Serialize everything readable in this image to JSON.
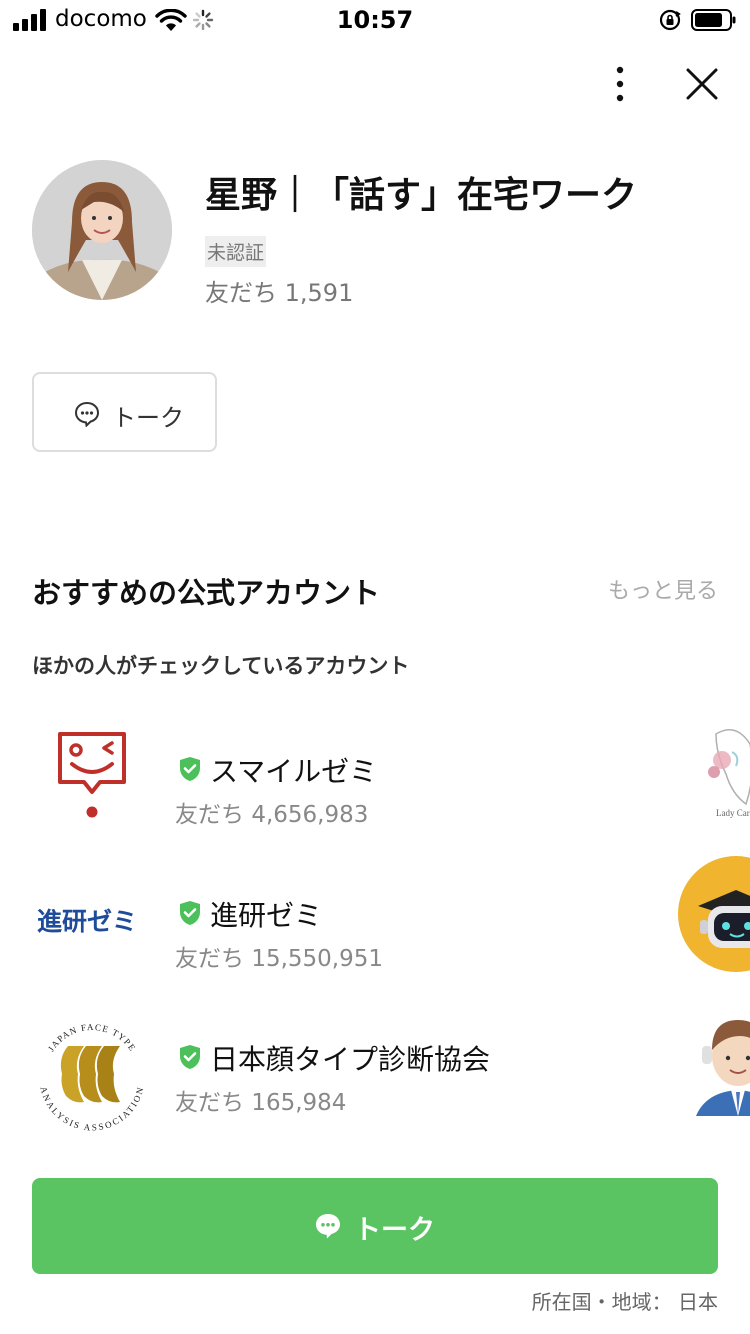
{
  "status_bar": {
    "carrier": "docomo",
    "time": "10:57",
    "signal_icon": "signal-bars-icon",
    "wifi_icon": "wifi-icon",
    "loading_icon": "activity-spinner-icon",
    "rotation_lock_icon": "rotation-lock-icon",
    "battery_icon": "battery-icon"
  },
  "header": {
    "more_icon": "vertical-ellipsis-icon",
    "close_icon": "close-icon"
  },
  "profile": {
    "name": "星野｜「話す」在宅ワーク",
    "verification": "未認証",
    "friends_label": "友だち",
    "friends_count": "1,591",
    "talk_button": "トーク",
    "talk_icon": "chat-bubble-icon"
  },
  "recommendations": {
    "title": "おすすめの公式アカウント",
    "see_more": "もっと見る",
    "subtitle": "ほかの人がチェックしているアカウント",
    "accounts": [
      {
        "name": "スマイルゼミ",
        "friends_label": "友だち",
        "friends": "4,656,983",
        "verified_icon": "verified-shield-icon"
      },
      {
        "name": "進研ゼミ",
        "friends_label": "友だち",
        "friends": "15,550,951",
        "logo_text": "進研ゼミ",
        "verified_icon": "verified-shield-icon"
      },
      {
        "name": "日本顔タイプ診断協会",
        "friends_label": "友だち",
        "friends": "165,984",
        "logo_text_top": "JAPAN FACE TYPE",
        "logo_text_bottom": "ANALYSIS ASSOCIATION",
        "verified_icon": "verified-shield-icon"
      }
    ],
    "side_thumb_caption": "Lady Car"
  },
  "footer": {
    "talk_button": "トーク",
    "talk_icon": "chat-bubble-icon",
    "region_label": "所在国・地域：",
    "region_value": "日本"
  },
  "colors": {
    "primary_green": "#5ac463",
    "verified_green": "#4cc05a",
    "smile_red": "#c0302b",
    "shinken_blue": "#1f4c9a",
    "face_gold": "#c9a227"
  }
}
